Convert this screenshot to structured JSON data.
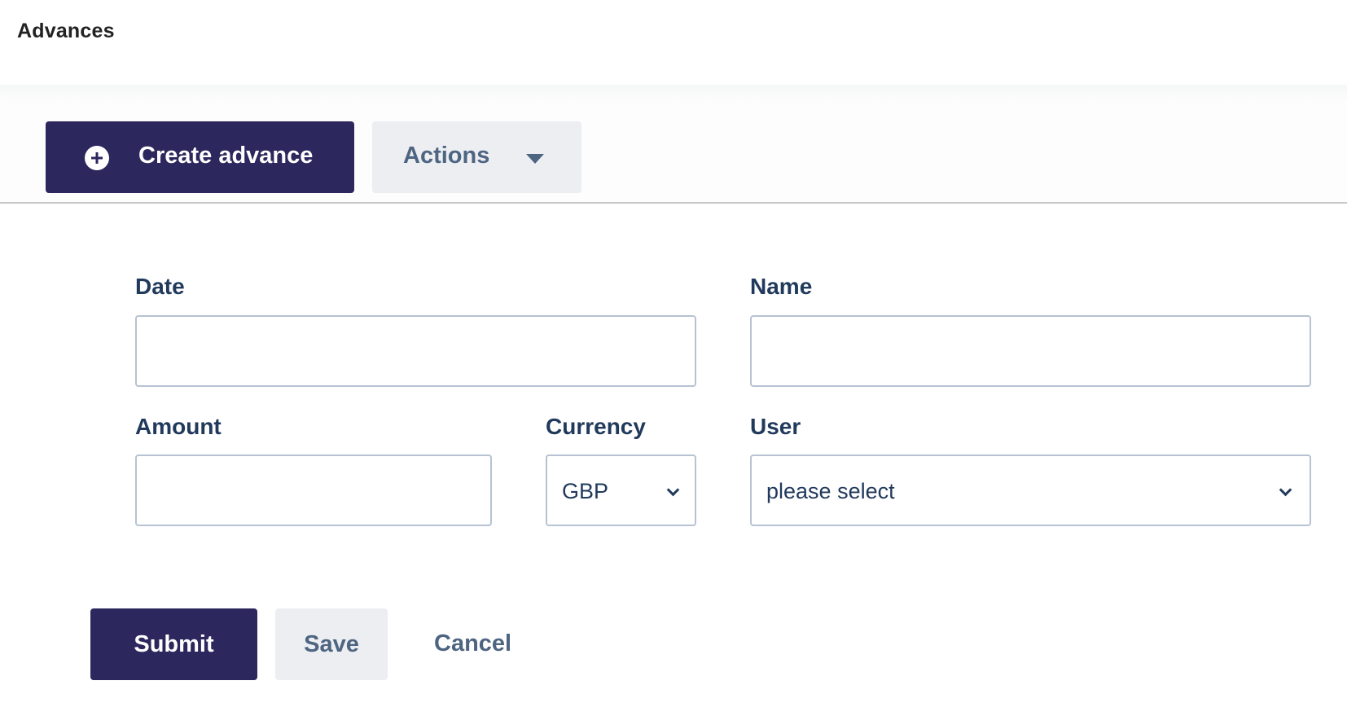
{
  "header": {
    "title": "Advances"
  },
  "toolbar": {
    "create_label": "Create advance",
    "create_icon": "plus-circle-icon",
    "actions_label": "Actions",
    "actions_icon": "caret-down-icon"
  },
  "form": {
    "date": {
      "label": "Date",
      "value": "",
      "placeholder": ""
    },
    "name": {
      "label": "Name",
      "value": "",
      "placeholder": ""
    },
    "amount": {
      "label": "Amount",
      "value": "",
      "placeholder": ""
    },
    "currency": {
      "label": "Currency",
      "selected": "GBP"
    },
    "user": {
      "label": "User",
      "selected": "please select"
    }
  },
  "footer": {
    "submit_label": "Submit",
    "save_label": "Save",
    "cancel_label": "Cancel"
  },
  "colors": {
    "primary": "#2c275d",
    "secondary_bg": "#edeef2",
    "secondary_text": "#4e6582",
    "label_text": "#213a5c",
    "input_border": "#b7c3d2"
  }
}
